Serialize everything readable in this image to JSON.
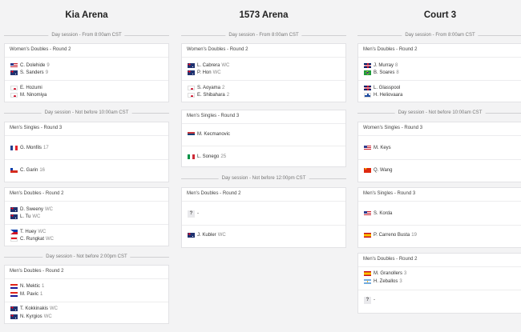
{
  "columns": [
    {
      "title": "Kia Arena",
      "sessions": [
        "Day session - From 8:00am CST",
        "Day session - Not before 10:00am CST",
        "Day session - Not before 2:00pm CST"
      ],
      "matches": [
        {
          "round": "Women's Doubles - Round 2",
          "t1": [
            {
              "name": "C. Dolehide",
              "seed": "9",
              "flag": "usa"
            },
            {
              "name": "S. Sanders",
              "seed": "9",
              "flag": "aus"
            }
          ],
          "t2": [
            {
              "name": "E. Hozumi",
              "seed": "",
              "flag": "jpn"
            },
            {
              "name": "M. Ninomiya",
              "seed": "",
              "flag": "jpn"
            }
          ]
        },
        {
          "round": "Men's Singles - Round 3",
          "t1": [
            {
              "name": "G. Monfils",
              "seed": "17",
              "flag": "fra"
            }
          ],
          "t2": [
            {
              "name": "C. Garin",
              "seed": "16",
              "flag": "chi"
            }
          ]
        },
        {
          "round": "Men's Doubles - Round 2",
          "t1": [
            {
              "name": "D. Sweeny",
              "seed": "WC",
              "flag": "aus"
            },
            {
              "name": "L. Tu",
              "seed": "WC",
              "flag": "aus"
            }
          ],
          "t2": [
            {
              "name": "T. Huey",
              "seed": "WC",
              "flag": "phi"
            },
            {
              "name": "C. Rungkat",
              "seed": "WC",
              "flag": "ina"
            }
          ]
        },
        {
          "round": "Men's Doubles - Round 2",
          "t1": [
            {
              "name": "N. Mektic",
              "seed": "1",
              "flag": "cro"
            },
            {
              "name": "M. Pavic",
              "seed": "1",
              "flag": "cro"
            }
          ],
          "t2": [
            {
              "name": "T. Kokkinakis",
              "seed": "WC",
              "flag": "aus"
            },
            {
              "name": "N. Kyrgios",
              "seed": "WC",
              "flag": "aus"
            }
          ]
        }
      ]
    },
    {
      "title": "1573 Arena",
      "sessions": [
        "Day session - From 8:00am CST",
        "Day session - Not before 12:00pm CST"
      ],
      "matches": [
        {
          "round": "Women's Doubles - Round 2",
          "t1": [
            {
              "name": "L. Cabrera",
              "seed": "WC",
              "flag": "aus"
            },
            {
              "name": "P. Hon",
              "seed": "WC",
              "flag": "aus"
            }
          ],
          "t2": [
            {
              "name": "S. Aoyama",
              "seed": "2",
              "flag": "jpn"
            },
            {
              "name": "E. Shibahara",
              "seed": "2",
              "flag": "jpn"
            }
          ]
        },
        {
          "round": "Men's Singles - Round 3",
          "t1": [
            {
              "name": "M. Kecmanovic",
              "seed": "",
              "flag": "srb"
            }
          ],
          "t2": [
            {
              "name": "L. Sonego",
              "seed": "25",
              "flag": "ita"
            }
          ]
        },
        {
          "round": "Men's Doubles - Round 2",
          "t1": [
            {
              "name": "-",
              "seed": "",
              "flag": "tbd"
            }
          ],
          "t2": [
            {
              "name": "J. Kubler",
              "seed": "WC",
              "flag": "aus"
            }
          ]
        }
      ]
    },
    {
      "title": "Court 3",
      "sessions": [
        "Day session - From 8:00am CST",
        "Day session - Not before 10:00am CST"
      ],
      "matches": [
        {
          "round": "Men's Doubles - Round 2",
          "t1": [
            {
              "name": "J. Murray",
              "seed": "8",
              "flag": "gbr"
            },
            {
              "name": "B. Soares",
              "seed": "8",
              "flag": "bra"
            }
          ],
          "t2": [
            {
              "name": "L. Glasspool",
              "seed": "",
              "flag": "gbr"
            },
            {
              "name": "H. Heliovaara",
              "seed": "",
              "flag": "fin"
            }
          ]
        },
        {
          "round": "Women's Singles - Round 3",
          "t1": [
            {
              "name": "M. Keys",
              "seed": "",
              "flag": "usa"
            }
          ],
          "t2": [
            {
              "name": "Q. Wang",
              "seed": "",
              "flag": "chn"
            }
          ]
        },
        {
          "round": "Men's Singles - Round 3",
          "t1": [
            {
              "name": "S. Korda",
              "seed": "",
              "flag": "usa"
            }
          ],
          "t2": [
            {
              "name": "P. Carreno Busta",
              "seed": "19",
              "flag": "esp"
            }
          ]
        },
        {
          "round": "Men's Doubles - Round 2",
          "t1": [
            {
              "name": "M. Granollers",
              "seed": "3",
              "flag": "esp"
            },
            {
              "name": "H. Zeballos",
              "seed": "3",
              "flag": "arg"
            }
          ],
          "t2": [
            {
              "name": "-",
              "seed": "",
              "flag": "tbd"
            }
          ]
        }
      ]
    }
  ],
  "tbd_glyph": "?"
}
